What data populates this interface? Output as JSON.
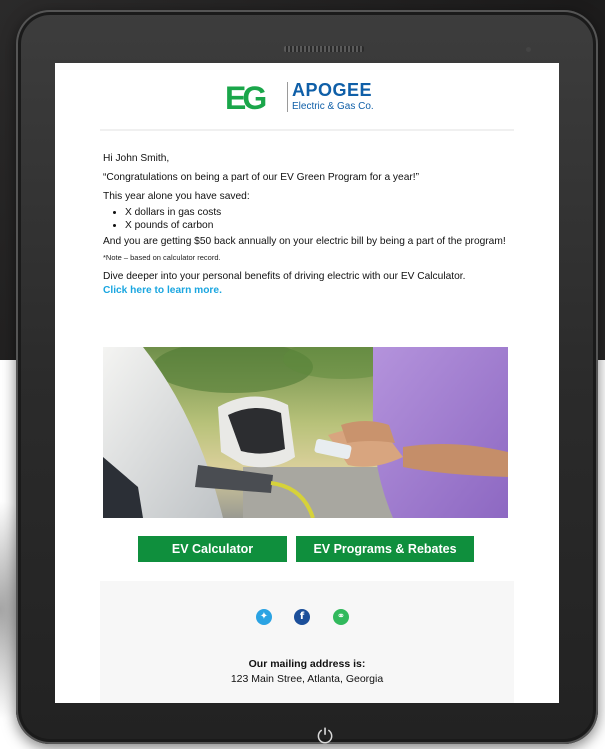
{
  "brand": {
    "logo_mark": "EG",
    "name": "APOGEE",
    "subtitle": "Electric & Gas Co.",
    "colors": {
      "green": "#1aa64a",
      "blue": "#0f5fa8"
    }
  },
  "email": {
    "greeting": "Hi John Smith,",
    "headline": "“Congratulations on being a part of our EV Green Program for a year!”",
    "savings_intro": "This year alone you have saved:",
    "savings": [
      "X dollars in gas costs",
      "X pounds of carbon"
    ],
    "rebate_text": "And you are getting $50 back annually on your electric bill by being a part of the program!",
    "note": "*Note – based on calculator record.",
    "cta_text": "Dive deeper into your personal benefits of driving electric with our EV Calculator.",
    "cta_link": "Click here to learn more.",
    "link_color": "#1aa6e0"
  },
  "hero_image": {
    "icon": "ev-charging-photo"
  },
  "buttons": {
    "calculator": "EV Calculator",
    "programs": "EV Programs & Rebates",
    "color": "#0f8f3d"
  },
  "footer": {
    "social": [
      {
        "icon": "twitter-icon",
        "glyph": "✦",
        "color": "#2ba3e3"
      },
      {
        "icon": "facebook-icon",
        "glyph": "f",
        "color": "#1c4f9a"
      },
      {
        "icon": "link-icon",
        "glyph": "⚭",
        "color": "#31b95c"
      }
    ],
    "mailing_heading": "Our mailing address is:",
    "mailing_address": "123 Main Stree, Atlanta, Georgia"
  },
  "device": {
    "power_glyph": "⏻"
  }
}
